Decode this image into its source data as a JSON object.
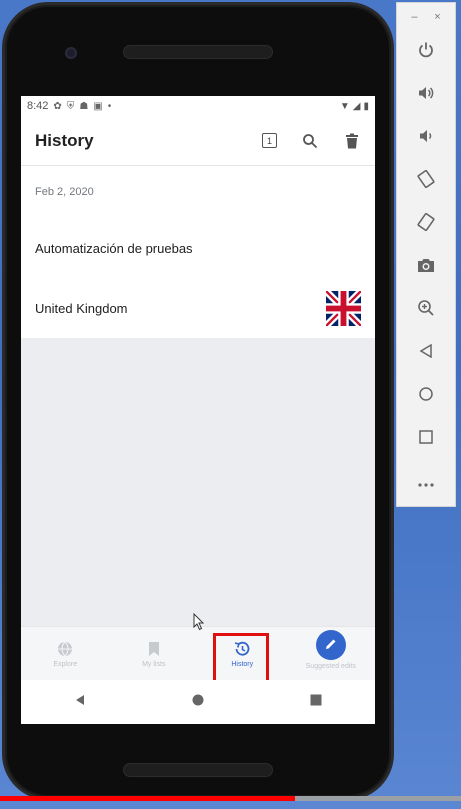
{
  "status_bar": {
    "time": "8:42"
  },
  "app_bar": {
    "title": "History",
    "tab_count": "1"
  },
  "history": {
    "date": "Feb 2, 2020",
    "items": [
      {
        "title": "Automatización de pruebas",
        "has_thumbnail": false
      },
      {
        "title": "United Kingdom",
        "has_thumbnail": true,
        "thumbnail": "uk-flag"
      }
    ]
  },
  "bottom_nav": {
    "items": [
      {
        "label": "Explore",
        "icon": "globe-icon",
        "active": false
      },
      {
        "label": "My lists",
        "icon": "bookmark-icon",
        "active": false
      },
      {
        "label": "History",
        "icon": "history-icon",
        "active": true
      },
      {
        "label": "Suggested edits",
        "icon": "pencil-icon",
        "active": false
      }
    ]
  },
  "emulator_panel": {
    "buttons": [
      "power-icon",
      "volume-up-icon",
      "volume-down-icon",
      "rotate-left-icon",
      "rotate-right-icon",
      "camera-icon",
      "zoom-icon",
      "back-icon",
      "home-icon",
      "overview-icon",
      "more-icon"
    ]
  },
  "video": {
    "progress": 0.64
  },
  "colors": {
    "accent": "#3366cc",
    "highlight": "#e01010",
    "progress": "#ff0000"
  }
}
